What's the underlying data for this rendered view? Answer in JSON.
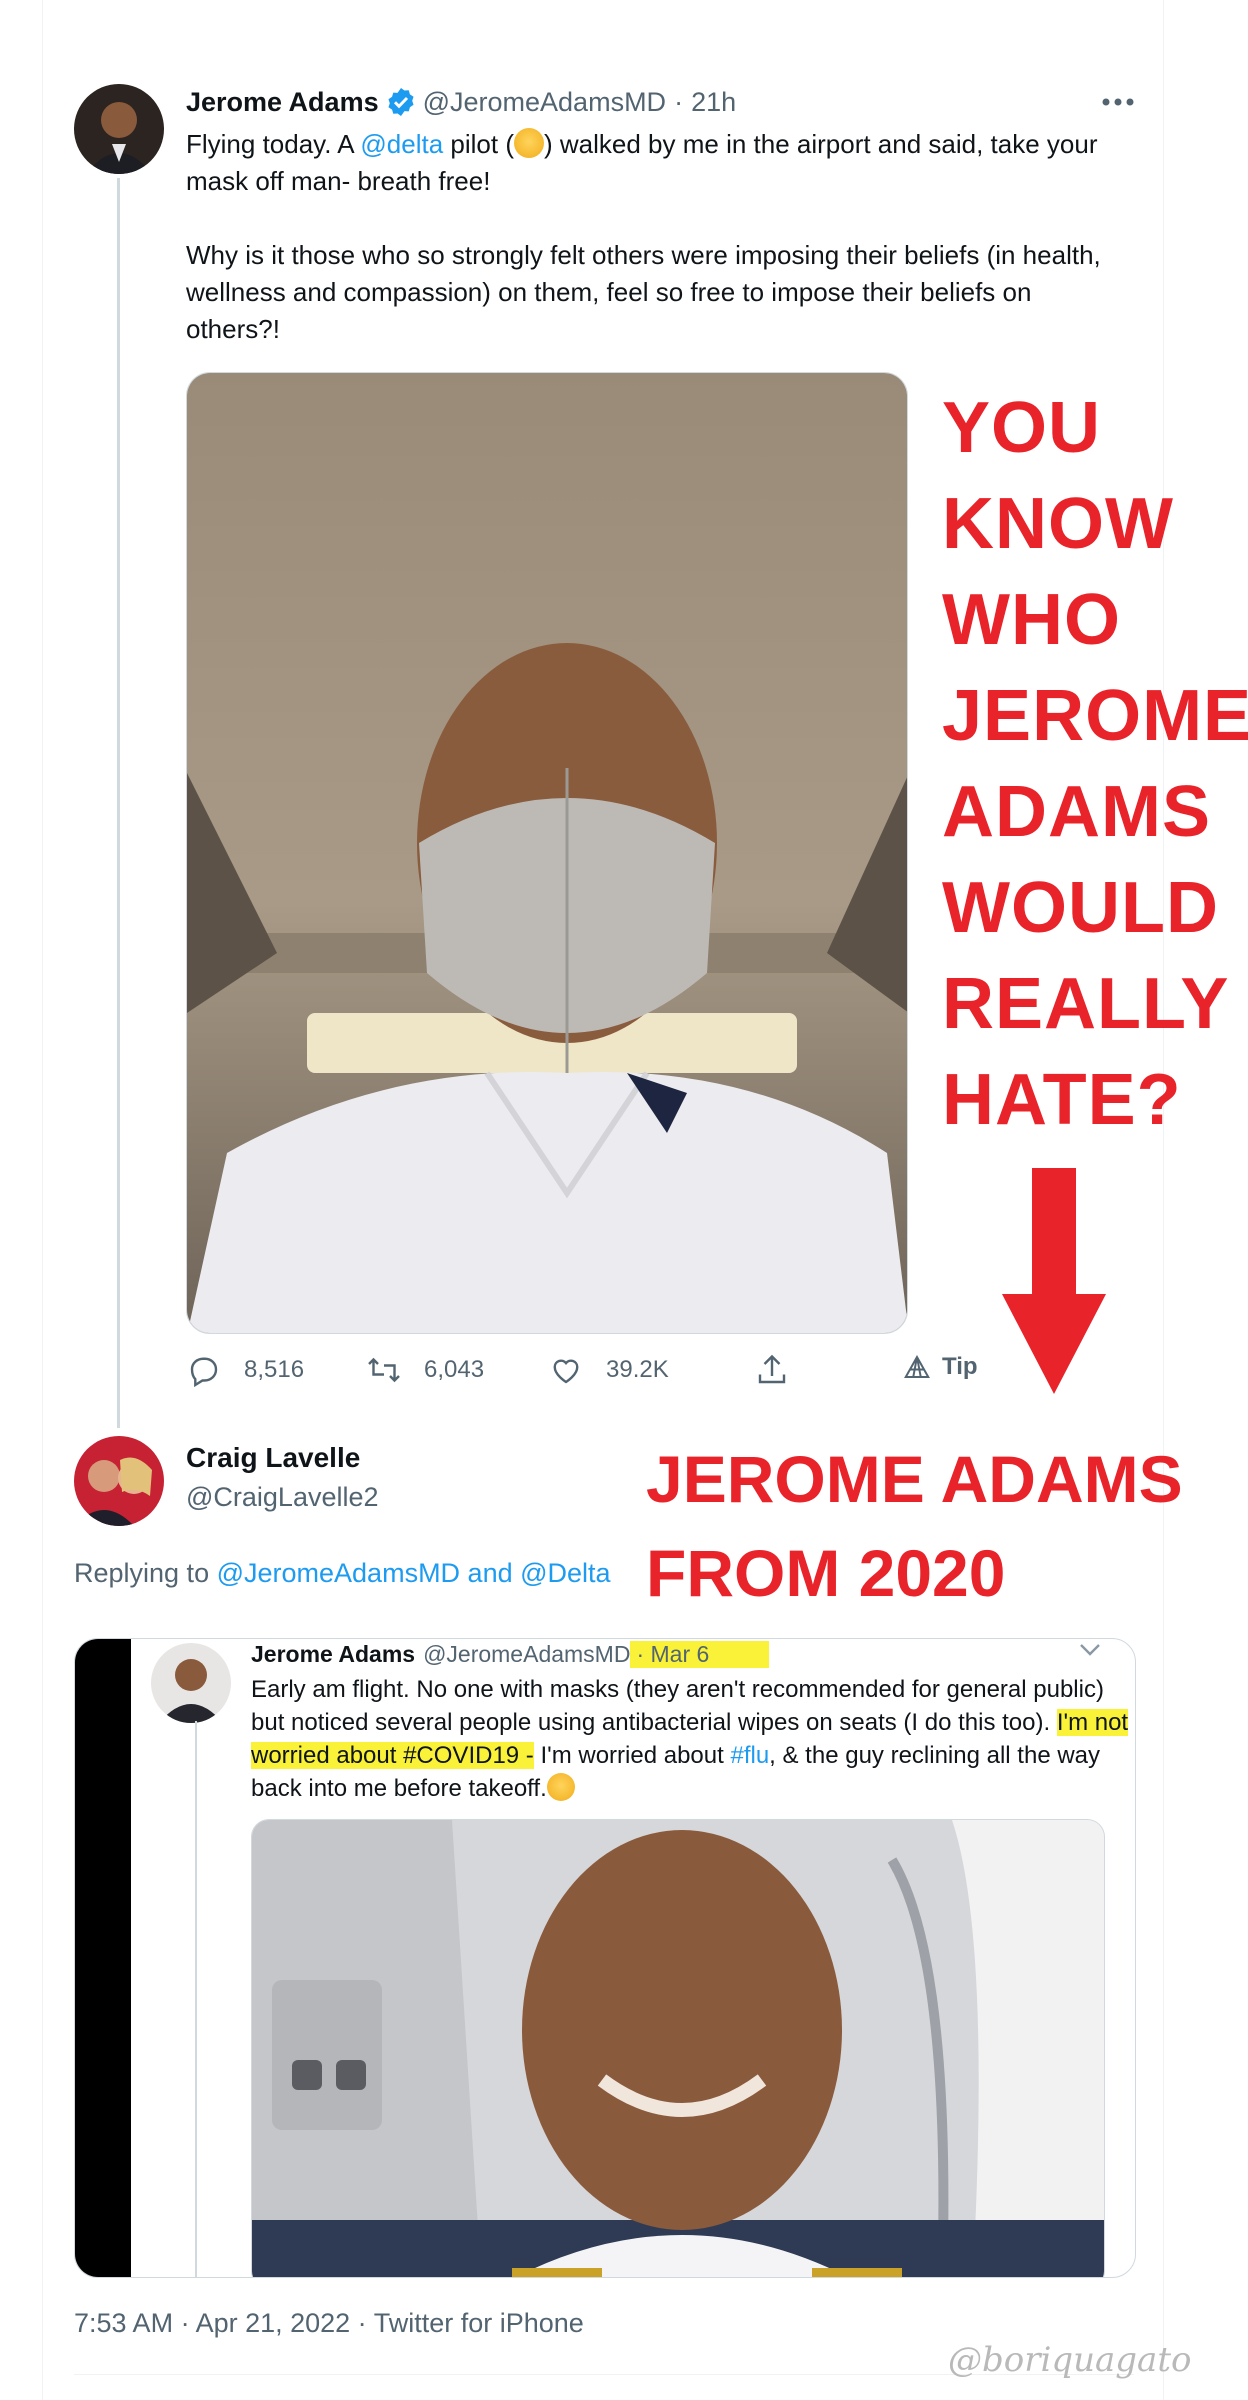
{
  "tweet": {
    "author_name": "Jerome Adams",
    "author_handle": "@JeromeAdamsMD",
    "separator": "·",
    "time": "21h",
    "text_before_link": "Flying today. A ",
    "mention_delta": "@delta",
    "text_after_link": " pilot (",
    "text_after_emoji": ") walked by me in the airport and said, take your mask off man- breath free!",
    "paragraph2": "Why is it those who so strongly felt others were imposing their beliefs (in health, wellness and compassion) on them, feel so free to impose their beliefs on others?!",
    "actions": {
      "replies": "8,516",
      "retweets": "6,043",
      "likes": "39.2K",
      "tip": "Tip"
    }
  },
  "overlay": {
    "lines": [
      "YOU",
      "KNOW",
      "WHO",
      "JEROME",
      "ADAMS",
      "WOULD",
      "REALLY",
      "HATE?"
    ],
    "caption_line1": "JEROME ADAMS",
    "caption_line2": "FROM 2020",
    "color": "#e8232a"
  },
  "reply": {
    "author_name": "Craig Lavelle",
    "author_handle": "@CraigLavelle2",
    "replying_prefix": "Replying to ",
    "replying_to": "@JeromeAdamsMD and @Delta",
    "inner_tweet": {
      "author_name": "Jerome Adams",
      "author_handle": "@JeromeAdamsMD",
      "date": "· Mar 6",
      "text_part1": "Early am flight. No one with masks (they aren't recommended for general public) but noticed several people using antibacterial wipes on seats (I do this too). ",
      "highlight_part": "I'm not worried about #COVID19 -",
      "text_part2": " I'm worried about ",
      "flu_tag": "#flu",
      "text_part3": ", & the guy reclining all the way back into me before takeoff."
    },
    "timestamp": "7:53 AM · Apr 21, 2022 · Twitter for iPhone"
  },
  "watermark": "@boriquagato",
  "colors": {
    "link": "#1d9bf0",
    "secondary_text": "#536471",
    "highlight": "#f9f238"
  },
  "icons": [
    "verified-badge-icon",
    "more-icon",
    "reply-icon",
    "retweet-icon",
    "like-icon",
    "share-icon",
    "tip-icon",
    "chevron-down-icon",
    "arrow-down-icon"
  ]
}
